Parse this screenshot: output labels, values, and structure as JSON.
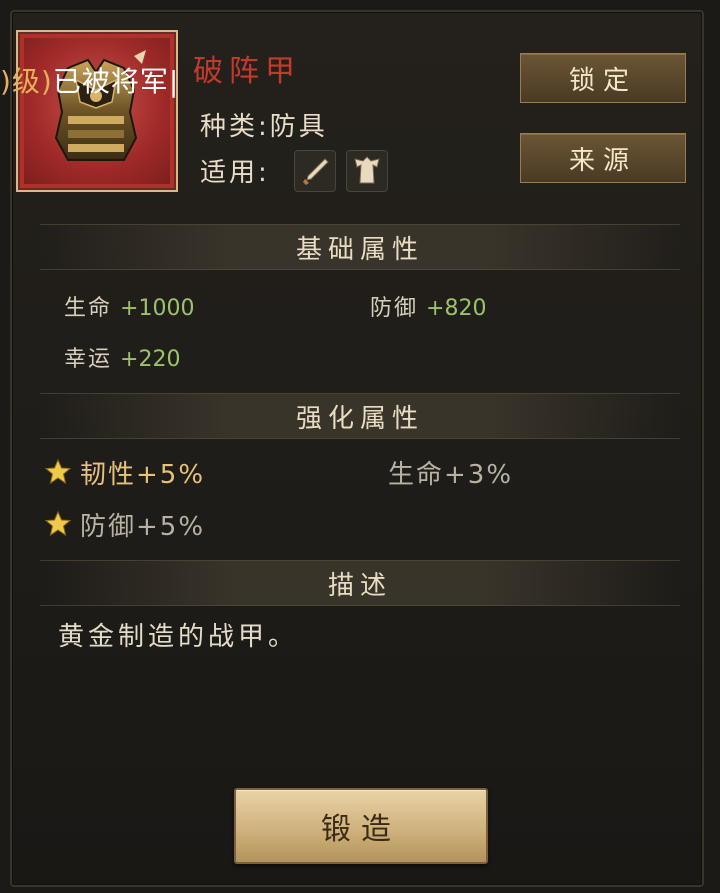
{
  "item": {
    "name": "破阵甲",
    "type_label": "种类:防具",
    "apply_label": "适用:",
    "apply_icons": [
      "sword-icon",
      "robe-icon"
    ],
    "overlay_level": ")级)",
    "overlay_text": "已被将军|"
  },
  "buttons": {
    "lock": "锁定",
    "source": "来源",
    "forge": "锻造"
  },
  "sections": {
    "base": "基础属性",
    "enhanced": "强化属性",
    "description": "描述"
  },
  "base_stats": [
    {
      "label": "生命",
      "value": "+1000"
    },
    {
      "label": "防御",
      "value": "+820"
    },
    {
      "label": "幸运",
      "value": "+220"
    }
  ],
  "enhanced_stats": [
    {
      "text": "韧性+5%",
      "starred": true
    },
    {
      "text": "生命+3%",
      "starred": false
    },
    {
      "text": "防御+5%",
      "starred": true
    }
  ],
  "description": "黄金制造的战甲。",
  "colors": {
    "item_name": "#c33a2d",
    "stat_value": "#9cc36a",
    "starred_stat": "#e6c27a",
    "frame_red": "#b2302c"
  }
}
